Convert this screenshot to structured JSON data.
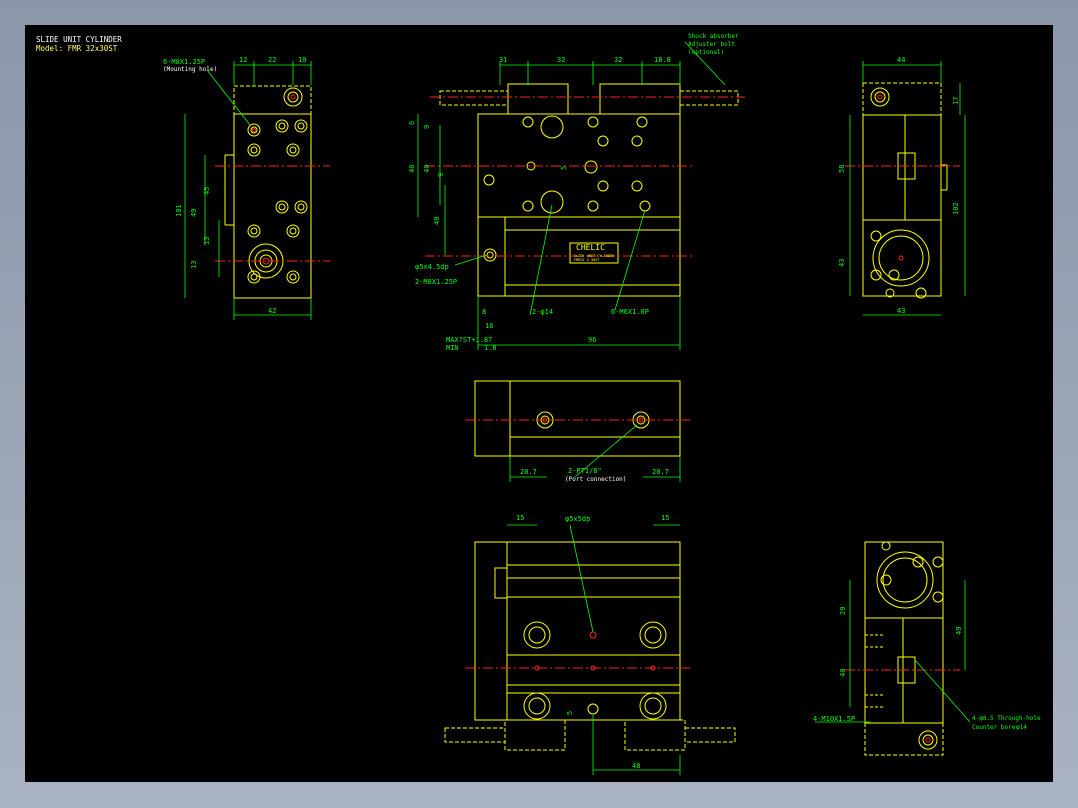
{
  "drawing": {
    "title": "SLIDE UNIT CYLINDER",
    "model": "Model: FMR 32x30ST"
  },
  "colors": {
    "background": "#000000",
    "outline": "#ffff00",
    "dimension": "#00ff00",
    "centerline": "#ff2020",
    "hidden": "#ffff00",
    "text": "#ffffff",
    "frame": "#8a97a9"
  },
  "labels": {
    "mount_hole": "6-M8X1.25P",
    "mount_hole_note": "(Mounting hole)",
    "shock_absorber": "Shock absorber",
    "adjuster_bolt": "Adjuster bolt",
    "optional": "(optional)",
    "pin_hole": "φ5x4.5dp",
    "tap_m8": "2-M8X1.25P",
    "phi14": "2-φ14",
    "tap_m6": "6-M6X1.0P",
    "stroke_max": "MAX?ST+1.87",
    "stroke_min": "MIN",
    "stroke_min_val": "1.8",
    "port": "2-PT1/8\"",
    "port_note": "(Port connection)",
    "pin_hole_b": "φ5x5dp",
    "tap_m10": "4-M10X1.5P",
    "through_hole": "4-φ8.5 Through-hole",
    "counter_bore": "Counter bore",
    "counter_bore_val": "φ14",
    "brand": "CHELIC",
    "nameplate_line1": "SLIDE UNIT CYLINDER",
    "nameplate_line2": "FMR32 X 30ST"
  },
  "dims": {
    "left": {
      "top_a": "12",
      "top_b": "22",
      "top_c": "10",
      "h_total": "101",
      "h_49": "49",
      "h_45": "45",
      "h_13a": "13",
      "h_13b": "13",
      "bottom": "42"
    },
    "front": {
      "top_a": "31",
      "top_b": "32",
      "top_c": "32",
      "top_d": "18.8",
      "v_6": "6",
      "v_9a": "9",
      "v_46": "46",
      "v_40a": "40",
      "v_9b": "9",
      "v_40b": "40",
      "v_5": "5",
      "h_8": "8",
      "h_16": "16",
      "h_96": "96"
    },
    "right": {
      "top": "44",
      "v_17": "17",
      "v_58": "58",
      "v_102": "102",
      "v_43": "43",
      "bottom": "43"
    },
    "mid": {
      "left": "20.7",
      "right": "20.7"
    },
    "bottom": {
      "top_left": "15",
      "top_right": "15",
      "v_5": "5",
      "h_48": "48"
    },
    "endview": {
      "v_29": "29",
      "v_40": "40",
      "v_49": "49"
    }
  }
}
